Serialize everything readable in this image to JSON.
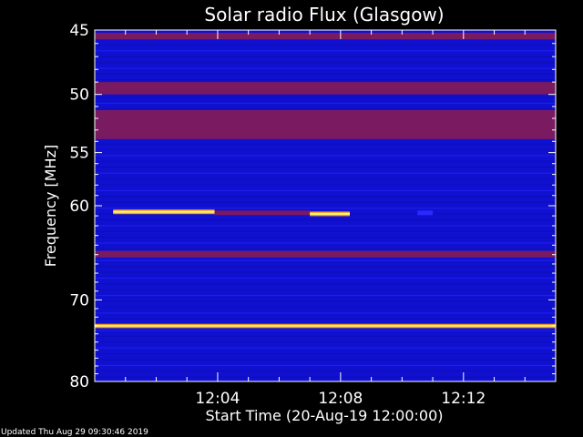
{
  "chart_data": {
    "type": "heatmap",
    "title": "Solar radio Flux (Glasgow)",
    "xlabel": "Start Time (20-Aug-19 12:00:00)",
    "ylabel": "Frequency [MHz]",
    "x_range_minutes": [
      0,
      15
    ],
    "y_range_mhz": [
      45,
      80
    ],
    "y_scale": "log",
    "x_ticks": [
      {
        "minute": 4,
        "label": "12:04"
      },
      {
        "minute": 8,
        "label": "12:08"
      },
      {
        "minute": 12,
        "label": "12:12"
      }
    ],
    "y_ticks": [
      {
        "mhz": 45,
        "label": "45"
      },
      {
        "mhz": 50,
        "label": "50"
      },
      {
        "mhz": 55,
        "label": "55"
      },
      {
        "mhz": 60,
        "label": "60"
      },
      {
        "mhz": 70,
        "label": "70"
      },
      {
        "mhz": 80,
        "label": "80"
      }
    ],
    "colors": {
      "background": "#000000",
      "low": "#1010d0",
      "mid": "#2a2aff",
      "band": "#7a1a60",
      "high": "#ff9a20",
      "peak": "#ffff80"
    },
    "bands": [
      {
        "mhz_from": 45.2,
        "mhz_to": 45.7,
        "level": "band"
      },
      {
        "mhz_from": 49.0,
        "mhz_to": 50.0,
        "level": "band"
      },
      {
        "mhz_from": 51.3,
        "mhz_to": 53.8,
        "level": "band"
      },
      {
        "mhz_from": 64.6,
        "mhz_to": 65.3,
        "level": "band"
      },
      {
        "mhz_from": 72.8,
        "mhz_to": 73.3,
        "level": "high"
      }
    ],
    "emissions": [
      {
        "minute_from": 0.6,
        "minute_to": 3.9,
        "mhz": 60.6,
        "level": "high"
      },
      {
        "minute_from": 3.9,
        "minute_to": 7.0,
        "mhz": 60.7,
        "level": "band"
      },
      {
        "minute_from": 7.0,
        "minute_to": 8.3,
        "mhz": 60.8,
        "level": "high"
      },
      {
        "minute_from": 10.5,
        "minute_to": 11.0,
        "mhz": 60.7,
        "level": "mid"
      }
    ]
  },
  "footer": {
    "updated": "Updated Thu Aug 29 09:30:46 2019"
  }
}
